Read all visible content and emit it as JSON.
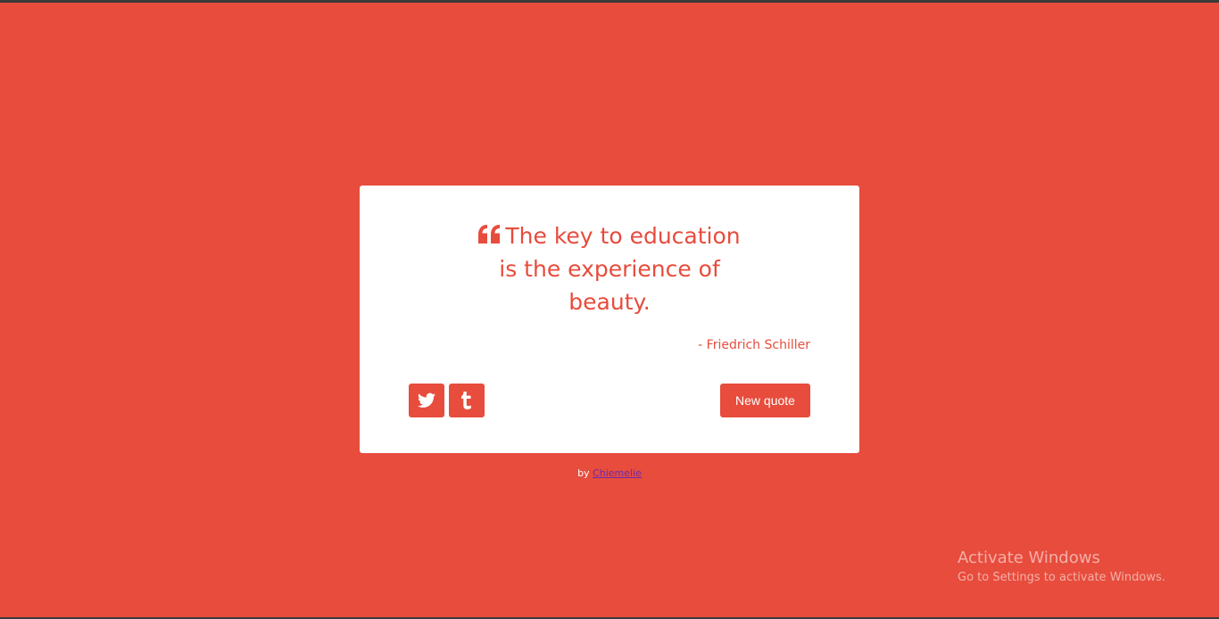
{
  "colors": {
    "background": "#e74c3c",
    "card": "#ffffff",
    "accent": "#e74c3c",
    "link": "#6b2bb0"
  },
  "quote": {
    "icon": "quote-left-icon",
    "text": "The key to education is the experience of beauty.",
    "author": "- Friedrich Schiller"
  },
  "share": {
    "twitter_icon": "twitter-icon",
    "tumblr_icon": "tumblr-icon"
  },
  "actions": {
    "new_quote_label": "New quote"
  },
  "footer": {
    "prefix": "by",
    "author_link": "Chiemelie"
  },
  "watermark": {
    "title": "Activate Windows",
    "subtitle": "Go to Settings to activate Windows."
  }
}
